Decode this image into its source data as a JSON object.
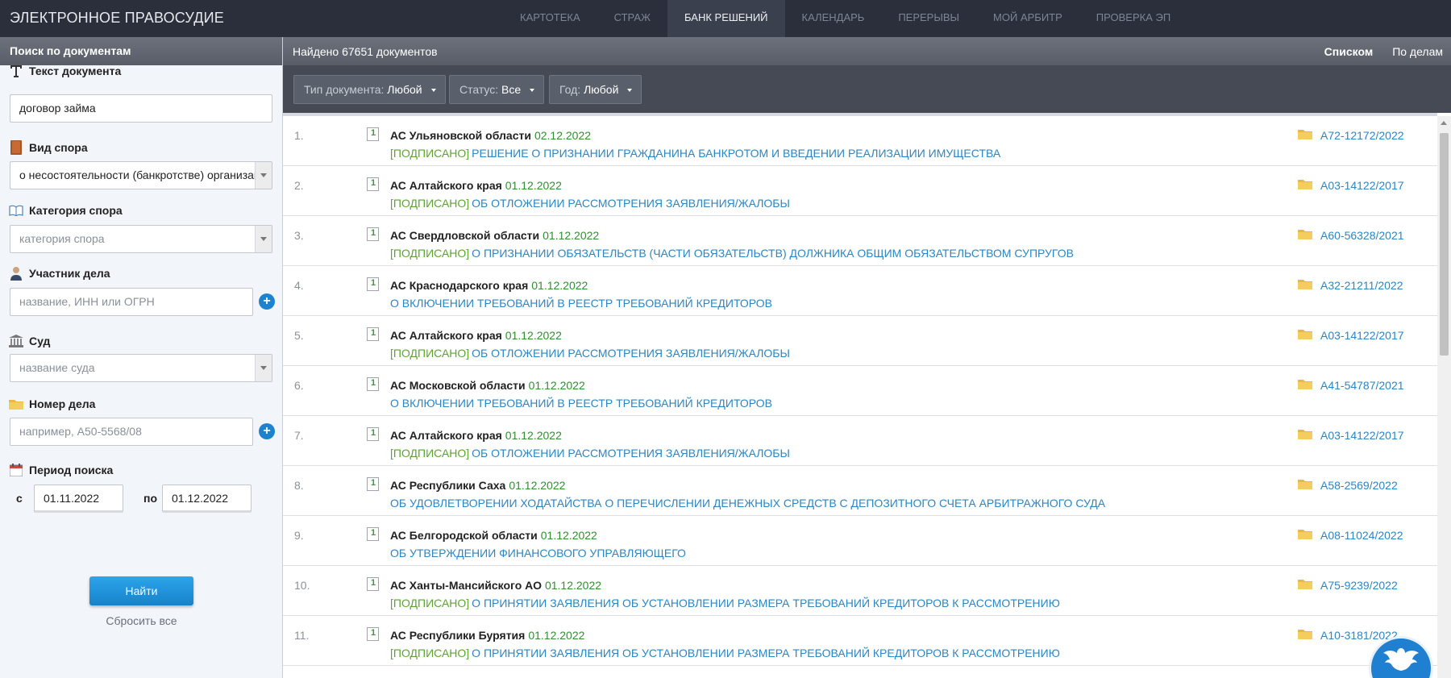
{
  "app": {
    "title": "ЭЛЕКТРОННОЕ ПРАВОСУДИЕ"
  },
  "nav": [
    {
      "label": "КАРТОТЕКА",
      "active": false
    },
    {
      "label": "СТРАЖ",
      "active": false
    },
    {
      "label": "БАНК РЕШЕНИЙ",
      "active": true
    },
    {
      "label": "КАЛЕНДАРЬ",
      "active": false
    },
    {
      "label": "ПЕРЕРЫВЫ",
      "active": false
    },
    {
      "label": "МОЙ АРБИТР",
      "active": false
    },
    {
      "label": "ПРОВЕРКА ЭП",
      "active": false
    }
  ],
  "sidebar": {
    "header": "Поиск по документам",
    "text": {
      "label": "Текст документа",
      "value": "договор займа",
      "icon": "text-t-icon"
    },
    "dispute_type": {
      "label": "Вид спора",
      "value": "о несостоятельности (банкротстве) организаций",
      "icon": "book-icon"
    },
    "dispute_category": {
      "label": "Категория спора",
      "placeholder": "категория спора",
      "icon": "open-book-icon"
    },
    "participant": {
      "label": "Участник дела",
      "placeholder": "название, ИНН или ОГРН",
      "icon": "person-icon"
    },
    "court": {
      "label": "Суд",
      "placeholder": "название суда",
      "icon": "courthouse-icon"
    },
    "case_number": {
      "label": "Номер дела",
      "placeholder": "например, А50-5568/08",
      "icon": "folder-icon"
    },
    "period": {
      "label": "Период поиска",
      "from_prefix": "с",
      "from": "01.11.2022",
      "to_prefix": "по",
      "to": "01.12.2022",
      "icon": "calendar-icon"
    },
    "find_button": "Найти",
    "reset_link": "Сбросить все"
  },
  "results_header": {
    "found": "Найдено 67651 документов",
    "view_list": "Списком",
    "view_cases": "По делам"
  },
  "filters": {
    "doc_type": {
      "label": "Тип документа:",
      "value": "Любой"
    },
    "status": {
      "label": "Статус:",
      "value": "Все"
    },
    "year": {
      "label": "Год:",
      "value": "Любой"
    }
  },
  "results": [
    {
      "num": "1.",
      "court": "АС Ульяновской области",
      "date": "02.12.2022",
      "signed": "[ПОДПИСАНО]",
      "title": "РЕШЕНИЕ О ПРИЗНАНИИ ГРАЖДАНИНА БАНКРОТОМ И ВВЕДЕНИИ РЕАЛИЗАЦИИ ИМУЩЕСТВА",
      "case": "А72-12172/2022"
    },
    {
      "num": "2.",
      "court": "АС Алтайского края",
      "date": "01.12.2022",
      "signed": "[ПОДПИСАНО]",
      "title": "ОБ ОТЛОЖЕНИИ РАССМОТРЕНИЯ ЗАЯВЛЕНИЯ/ЖАЛОБЫ",
      "case": "А03-14122/2017"
    },
    {
      "num": "3.",
      "court": "АС Свердловской области",
      "date": "01.12.2022",
      "signed": "[ПОДПИСАНО]",
      "title": "О ПРИЗНАНИИ ОБЯЗАТЕЛЬСТВ (ЧАСТИ ОБЯЗАТЕЛЬСТВ) ДОЛЖНИКА ОБЩИМ ОБЯЗАТЕЛЬСТВОМ СУПРУГОВ",
      "case": "А60-56328/2021"
    },
    {
      "num": "4.",
      "court": "АС Краснодарского края",
      "date": "01.12.2022",
      "signed": "",
      "title": "О ВКЛЮЧЕНИИ ТРЕБОВАНИЙ В РЕЕСТР ТРЕБОВАНИЙ КРЕДИТОРОВ",
      "case": "А32-21211/2022"
    },
    {
      "num": "5.",
      "court": "АС Алтайского края",
      "date": "01.12.2022",
      "signed": "[ПОДПИСАНО]",
      "title": "ОБ ОТЛОЖЕНИИ РАССМОТРЕНИЯ ЗАЯВЛЕНИЯ/ЖАЛОБЫ",
      "case": "А03-14122/2017"
    },
    {
      "num": "6.",
      "court": "АС Московской области",
      "date": "01.12.2022",
      "signed": "",
      "title": "О ВКЛЮЧЕНИИ ТРЕБОВАНИЙ В РЕЕСТР ТРЕБОВАНИЙ КРЕДИТОРОВ",
      "case": "А41-54787/2021"
    },
    {
      "num": "7.",
      "court": "АС Алтайского края",
      "date": "01.12.2022",
      "signed": "[ПОДПИСАНО]",
      "title": "ОБ ОТЛОЖЕНИИ РАССМОТРЕНИЯ ЗАЯВЛЕНИЯ/ЖАЛОБЫ",
      "case": "А03-14122/2017"
    },
    {
      "num": "8.",
      "court": "АС Республики Саха",
      "date": "01.12.2022",
      "signed": "",
      "title": "ОБ УДОВЛЕТВОРЕНИИ ХОДАТАЙСТВА О ПЕРЕЧИСЛЕНИИ ДЕНЕЖНЫХ СРЕДСТВ С ДЕПОЗИТНОГО СЧЕТА АРБИТРАЖНОГО СУДА",
      "case": "А58-2569/2022"
    },
    {
      "num": "9.",
      "court": "АС Белгородской области",
      "date": "01.12.2022",
      "signed": "",
      "title": "ОБ УТВЕРЖДЕНИИ ФИНАНСОВОГО УПРАВЛЯЮЩЕГО",
      "case": "А08-11024/2022"
    },
    {
      "num": "10.",
      "court": "АС Ханты-Мансийского АО",
      "date": "01.12.2022",
      "signed": "[ПОДПИСАНО]",
      "title": "О ПРИНЯТИИ ЗАЯВЛЕНИЯ ОБ УСТАНОВЛЕНИИ РАЗМЕРА ТРЕБОВАНИЙ КРЕДИТОРОВ К РАССМОТРЕНИЮ",
      "case": "А75-9239/2022"
    },
    {
      "num": "11.",
      "court": "АС Республики Бурятия",
      "date": "01.12.2022",
      "signed": "[ПОДПИСАНО]",
      "title": "О ПРИНЯТИИ ЗАЯВЛЕНИЯ ОБ УСТАНОВЛЕНИИ РАЗМЕРА ТРЕБОВАНИЙ КРЕДИТОРОВ К РАССМОТРЕНИЮ",
      "case": "А10-3181/2022"
    }
  ],
  "colors": {
    "topbar": "#2a2f3b",
    "link": "#2a86c4",
    "signed": "#5aa62e",
    "date": "#2f8f2f",
    "button": "#1e8fd8"
  }
}
